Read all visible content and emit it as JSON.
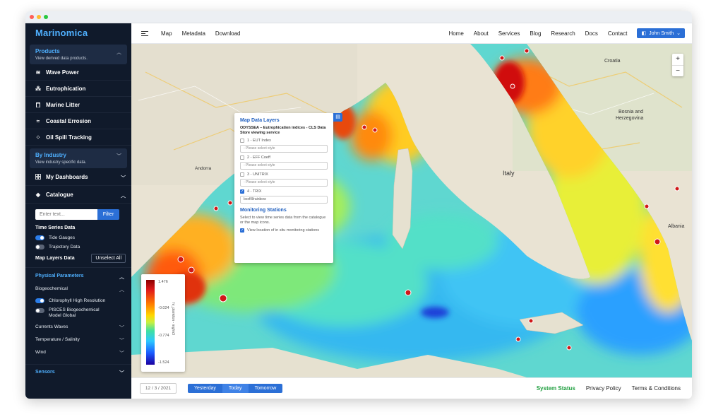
{
  "app": {
    "brand": "Marinomica"
  },
  "colors": {
    "sidebar_bg": "#101a2b",
    "accent": "#2b6fd6",
    "brand": "#4fb0ff",
    "status_green": "#1e9e3e"
  },
  "sidebar": {
    "products": {
      "title": "Products",
      "subtitle": "View derived data products."
    },
    "product_items": [
      {
        "label": "Wave Power",
        "icon": "wave-icon"
      },
      {
        "label": "Eutrophication",
        "icon": "molecule-icon"
      },
      {
        "label": "Marine Litter",
        "icon": "trash-icon"
      },
      {
        "label": "Coastal Errosion",
        "icon": "coast-icon"
      },
      {
        "label": "Oil Spill Tracking",
        "icon": "oil-drop-icon"
      }
    ],
    "industry": {
      "title": "By Industry",
      "subtitle": "View industry specific data."
    },
    "dashboards": "My Dashboards",
    "catalogue": "Catalogue",
    "filter": {
      "placeholder": "Enter text...",
      "button": "Filter"
    },
    "time_series": {
      "title": "Time Series Data",
      "items": [
        {
          "label": "Tide Gauges",
          "on": true
        },
        {
          "label": "Trajectory Data",
          "on": false
        }
      ]
    },
    "map_layers": {
      "title": "Map Layers Data",
      "unselect": "Unselect All"
    },
    "physical": {
      "title": "Physical Parameters"
    },
    "biogeochemical": "Biogeochemical",
    "bio_items": [
      {
        "label": "Chlorophyll High Resolution",
        "on": true
      },
      {
        "label": "PISCES Biogeochemical Model Global",
        "on": false
      }
    ],
    "other_params": [
      "Currents Waves",
      "Temperature / Salinity",
      "Wind"
    ],
    "sensors": "Sensors"
  },
  "topbar": {
    "left_links": [
      "Map",
      "Metadata",
      "Download"
    ],
    "right_links": [
      "Home",
      "About",
      "Services",
      "Blog",
      "Research",
      "Docs",
      "Contact"
    ],
    "user": "John Smith"
  },
  "map": {
    "zoom_in": "+",
    "zoom_out": "−",
    "labels": {
      "croatia": "Croatia",
      "bosnia1": "Bosnia and",
      "bosnia2": "Herzegovina",
      "italy": "Italy",
      "andorra": "Andorra",
      "albania": "Albania"
    }
  },
  "panel": {
    "title": "Map Data Layers",
    "description": "ODYSSEA – Eutrophication indices - CLS Data Store viewing service",
    "layers": [
      {
        "label": "1 - EUT Index",
        "checked": false,
        "style": "- Please select style"
      },
      {
        "label": "2 - EFF Coeff",
        "checked": false,
        "style": "- Please select style"
      },
      {
        "label": "3 - UNITRIX",
        "checked": false,
        "style": "- Please select style"
      },
      {
        "label": "4 - TRIX",
        "checked": true,
        "style": "boxfill/rainbow"
      }
    ],
    "monitoring": {
      "title": "Monitoring Stations",
      "description": "Select to view time series data from the catalogue or the map icons.",
      "checkbox": "View location of in situ monitoring stations",
      "checked": true
    }
  },
  "legend": {
    "ticks": [
      "1.476",
      "-0.024",
      "-0.774",
      "-1.524"
    ],
    "unit": "hr_plankton - mg/m3"
  },
  "bottombar": {
    "date": "12 / 3 / 2021",
    "buttons": [
      "Yesterday",
      "Today",
      "Tomorrow"
    ],
    "links": [
      "System Status",
      "Privacy Policy",
      "Terms & Conditions"
    ]
  }
}
